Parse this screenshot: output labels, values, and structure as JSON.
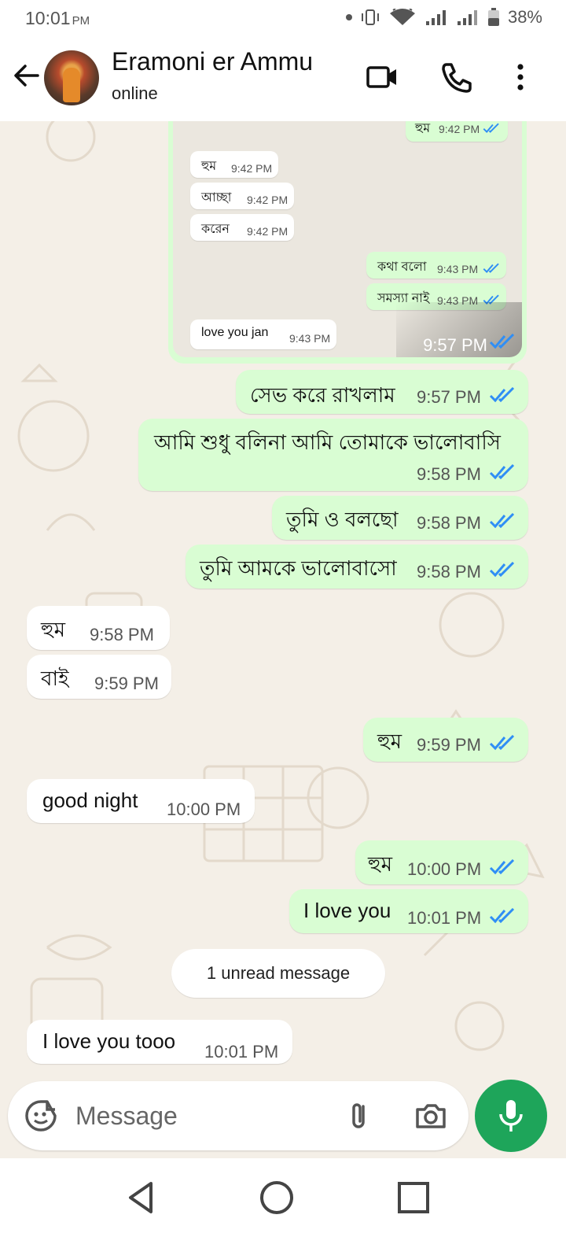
{
  "status_bar": {
    "time": "10:01",
    "ampm": "PM",
    "battery": "38%"
  },
  "header": {
    "contact_name": "Eramoni er Ammu",
    "presence": "online"
  },
  "forwarded_screenshot": {
    "messages": [
      {
        "text": "হুম",
        "time": "9:42 PM",
        "dir": "out"
      },
      {
        "text": "হুম",
        "time": "9:42 PM",
        "dir": "in"
      },
      {
        "text": "আচ্ছা",
        "time": "9:42 PM",
        "dir": "in"
      },
      {
        "text": "করেন",
        "time": "9:42 PM",
        "dir": "in"
      },
      {
        "text": "কথা বলো",
        "time": "9:43 PM",
        "dir": "out"
      },
      {
        "text": "সমস্যা নাই",
        "time": "9:43 PM",
        "dir": "out"
      },
      {
        "text": "love you jan",
        "time": "9:43 PM",
        "dir": "in"
      }
    ],
    "sent_time": "9:57 PM"
  },
  "messages": [
    {
      "text": "সেভ করে রাখলাম",
      "time": "9:57 PM",
      "dir": "out"
    },
    {
      "text": "আমি শুধু বলিনা আমি তোমাকে ভালোবাসি",
      "time": "9:58 PM",
      "dir": "out"
    },
    {
      "text": "তুমি ও বলছো",
      "time": "9:58 PM",
      "dir": "out"
    },
    {
      "text": "তুমি আমকে ভালোবাসো",
      "time": "9:58 PM",
      "dir": "out"
    },
    {
      "text": "হুম",
      "time": "9:58 PM",
      "dir": "in"
    },
    {
      "text": "বাই",
      "time": "9:59 PM",
      "dir": "in"
    },
    {
      "text": "হুম",
      "time": "9:59 PM",
      "dir": "out"
    },
    {
      "text": "good night",
      "time": "10:00 PM",
      "dir": "in"
    },
    {
      "text": "হুম",
      "time": "10:00 PM",
      "dir": "out"
    },
    {
      "text": "I love you",
      "time": "10:01 PM",
      "dir": "out"
    },
    {
      "text": "I love you tooo",
      "time": "10:01 PM",
      "dir": "in"
    }
  ],
  "unread_label": "1 unread message",
  "composer": {
    "placeholder": "Message"
  },
  "colors": {
    "outgoing_bubble": "#d9fdd3",
    "incoming_bubble": "#ffffff",
    "chat_background": "#f4efe7",
    "read_tick": "#2f8ef5",
    "mic_button": "#1ea55a"
  },
  "icons": [
    "back-arrow-icon",
    "video-call-icon",
    "phone-icon",
    "more-vert-icon",
    "sticker-icon",
    "attach-icon",
    "camera-icon",
    "mic-icon",
    "nav-back-icon",
    "nav-home-icon",
    "nav-recents-icon"
  ]
}
